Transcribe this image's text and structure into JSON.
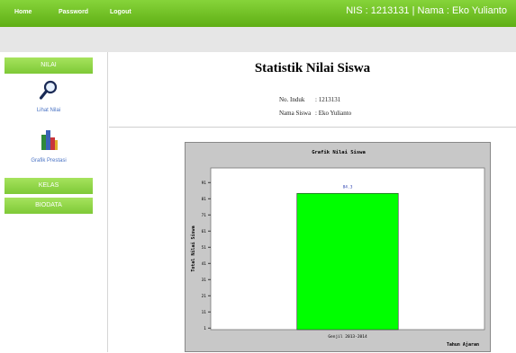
{
  "nav": {
    "home": "Home",
    "password": "Password",
    "logout": "Logout"
  },
  "user_info": "NIS : 1213131 | Nama : Eko Yulianto",
  "sidebar": {
    "nilai": "NILAI",
    "lihat_nilai": "Lihat Nilai",
    "grafik_prestasi": "Grafik Prestasi",
    "kelas": "KELAS",
    "biodata": "BIODATA"
  },
  "main": {
    "title": "Statistik Nilai Siswa",
    "no_induk_label": "No. Induk",
    "no_induk_value": ": 1213131",
    "nama_label": "Nama Siswa",
    "nama_value": ": Eko Yulianto"
  },
  "colors": {
    "topbar": "#6fc020",
    "bar": "#00ff00",
    "sidebar_btn": "#8ed246"
  },
  "icons": {
    "lihat_nilai": "magnifier-icon",
    "grafik_prestasi": "bar-chart-icon"
  },
  "chart_data": {
    "type": "bar",
    "title": "Grafik Nilai Siswa",
    "xlabel": "Tahun Ajaran",
    "ylabel": "Total Nilai Siswa",
    "categories": [
      "Genjil 2013-2014"
    ],
    "values": [
      84.3
    ],
    "data_labels": [
      "84.3"
    ],
    "yticks": [
      1,
      11,
      21,
      31,
      41,
      51,
      61,
      71,
      81,
      91
    ],
    "ylim": [
      0,
      100
    ]
  }
}
